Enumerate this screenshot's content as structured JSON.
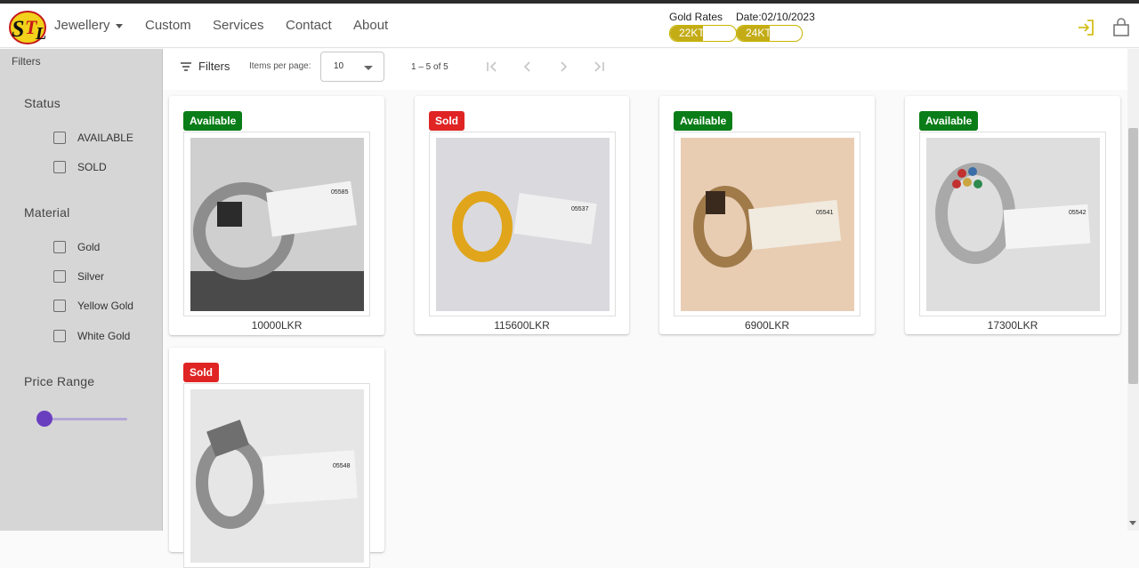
{
  "header": {
    "logo_text": "STL",
    "nav": [
      {
        "label": "Jewellery",
        "has_dropdown": true
      },
      {
        "label": "Custom"
      },
      {
        "label": "Services"
      },
      {
        "label": "Contact"
      },
      {
        "label": "About"
      }
    ],
    "gold_rates_label": "Gold Rates",
    "date_label": "Date:02/10/2023",
    "rates": [
      {
        "label": "22KT",
        "fill_fraction": 0.5
      },
      {
        "label": "24KT",
        "fill_fraction": 0.5
      }
    ],
    "icons": [
      "login-icon",
      "shopping-bag-icon"
    ],
    "accent_color": "#c8b400"
  },
  "sidebar": {
    "title": "Filters",
    "groups": [
      {
        "title": "Status",
        "options": [
          {
            "label": "AVAILABLE",
            "checked": false
          },
          {
            "label": "SOLD",
            "checked": false
          }
        ]
      },
      {
        "title": "Material",
        "options": [
          {
            "label": "Gold",
            "checked": false
          },
          {
            "label": "Silver",
            "checked": false
          },
          {
            "label": "Yellow Gold",
            "checked": false
          },
          {
            "label": "White Gold",
            "checked": false
          }
        ]
      },
      {
        "title": "Price Range",
        "slider_value_fraction": 0
      }
    ],
    "slider_color": "#6a3fbf"
  },
  "toolbar": {
    "filters_label": "Filters",
    "items_per_page_label": "Items per page:",
    "items_per_page_value": "10",
    "range_label": "1 – 5 of 5",
    "pagination_icons": [
      "first-page-icon",
      "previous-page-icon",
      "next-page-icon",
      "last-page-icon"
    ]
  },
  "products": [
    {
      "status": "Available",
      "price": "10000LKR",
      "tag_code": "05585"
    },
    {
      "status": "Sold",
      "price": "115600LKR",
      "tag_code": "05537"
    },
    {
      "status": "Available",
      "price": "6900LKR",
      "tag_code": "05541"
    },
    {
      "status": "Available",
      "price": "17300LKR",
      "tag_code": "05542"
    },
    {
      "status": "Sold",
      "price": "",
      "tag_code": "05548"
    }
  ],
  "status_colors": {
    "Available": "#0b7d18",
    "Sold": "#e02424"
  }
}
